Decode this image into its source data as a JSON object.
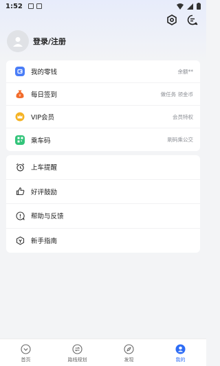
{
  "status_bar": {
    "time": "1:52"
  },
  "profile": {
    "login_label": "登录/注册"
  },
  "section1": {
    "items": [
      {
        "label": "我的零钱",
        "value": "余额**",
        "icon": "wallet-icon",
        "color": "#4a7df7"
      },
      {
        "label": "每日签到",
        "value": "做任务 领金币",
        "icon": "money-bag-icon",
        "color": "#f26b2a"
      },
      {
        "label": "VIP会员",
        "value": "会员特权",
        "icon": "crown-icon",
        "color": "#f5b324"
      },
      {
        "label": "乘车码",
        "value": "刷码乘公交",
        "icon": "qr-code-icon",
        "color": "#33c47a"
      }
    ]
  },
  "section2": {
    "items": [
      {
        "label": "上车提醒",
        "icon": "alarm-clock-icon"
      },
      {
        "label": "好评鼓励",
        "icon": "thumbs-up-icon"
      },
      {
        "label": "帮助与反馈",
        "icon": "help-feedback-icon"
      },
      {
        "label": "新手指南",
        "icon": "guide-icon"
      }
    ]
  },
  "tabbar": {
    "tabs": [
      {
        "label": "首页",
        "icon": "home-icon",
        "active": false
      },
      {
        "label": "路线规划",
        "icon": "route-icon",
        "active": false
      },
      {
        "label": "发现",
        "icon": "compass-icon",
        "active": false
      },
      {
        "label": "我的",
        "icon": "user-icon",
        "active": true
      }
    ],
    "active_color": "#2d6cf5"
  }
}
